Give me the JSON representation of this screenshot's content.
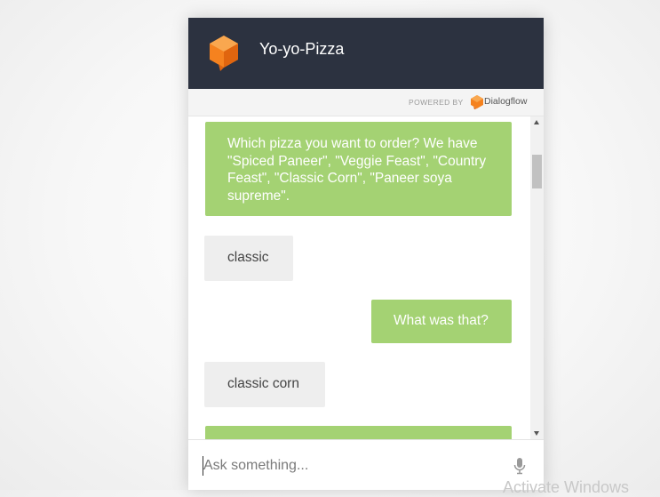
{
  "header": {
    "title": "Yo-yo-Pizza",
    "logo_icon": "orange-cube-chat-icon",
    "background_color": "#2c3240"
  },
  "powered_by": {
    "label": "POWERED BY",
    "brand": "Dialogflow",
    "brand_icon": "dialogflow-icon"
  },
  "messages": [
    {
      "sender": "bot",
      "text": "Which pizza you want to order? We have \"Spiced Paneer\", \"Veggie Feast\", \"Country Feast\", \"Classic Corn\", \"Paneer soya supreme\"."
    },
    {
      "sender": "user",
      "text": "classic"
    },
    {
      "sender": "bot",
      "text": "What was that?"
    },
    {
      "sender": "user",
      "text": "classic corn"
    },
    {
      "sender": "bot",
      "text": ""
    }
  ],
  "input": {
    "placeholder": "Ask something...",
    "value": "",
    "mic_icon": "microphone-icon"
  },
  "watermark": {
    "text": "Activate Windows"
  },
  "colors": {
    "bot_bubble": "#a4d273",
    "user_bubble": "#eeeeee",
    "accent": "#f5821f"
  }
}
